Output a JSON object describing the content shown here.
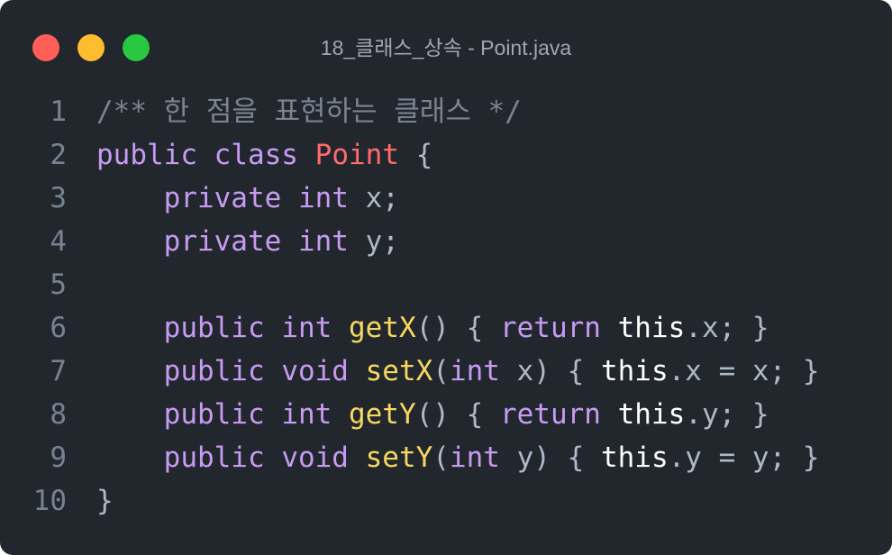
{
  "window": {
    "title": "18_클래스_상속 - Point.java",
    "controls": {
      "close": "close-button",
      "minimize": "minimize-button",
      "zoom": "zoom-button"
    }
  },
  "colors": {
    "background": "#22272e",
    "close": "#ff5f57",
    "minimize": "#febc2e",
    "zoom": "#28c840",
    "keyword": "#c79bf2",
    "class_name": "#ff6b6b",
    "method": "#f6d860",
    "this": "#ffffff",
    "comment": "#7a8592",
    "plain": "#adbac7",
    "line_number": "#768390"
  },
  "code": {
    "lines": [
      {
        "number": "1",
        "tokens": [
          {
            "t": "/** 한 점을 표현하는 클래스 */",
            "c": "cm"
          }
        ]
      },
      {
        "number": "2",
        "tokens": [
          {
            "t": "public",
            "c": "kw"
          },
          {
            "t": " ",
            "c": "pl"
          },
          {
            "t": "class",
            "c": "kw"
          },
          {
            "t": " ",
            "c": "pl"
          },
          {
            "t": "Point",
            "c": "cls"
          },
          {
            "t": " {",
            "c": "pl"
          }
        ]
      },
      {
        "number": "3",
        "tokens": [
          {
            "t": "    ",
            "c": "pl"
          },
          {
            "t": "private",
            "c": "kw"
          },
          {
            "t": " ",
            "c": "pl"
          },
          {
            "t": "int",
            "c": "kw"
          },
          {
            "t": " x;",
            "c": "pl"
          }
        ]
      },
      {
        "number": "4",
        "tokens": [
          {
            "t": "    ",
            "c": "pl"
          },
          {
            "t": "private",
            "c": "kw"
          },
          {
            "t": " ",
            "c": "pl"
          },
          {
            "t": "int",
            "c": "kw"
          },
          {
            "t": " y;",
            "c": "pl"
          }
        ]
      },
      {
        "number": "5",
        "tokens": []
      },
      {
        "number": "6",
        "tokens": [
          {
            "t": "    ",
            "c": "pl"
          },
          {
            "t": "public",
            "c": "kw"
          },
          {
            "t": " ",
            "c": "pl"
          },
          {
            "t": "int",
            "c": "kw"
          },
          {
            "t": " ",
            "c": "pl"
          },
          {
            "t": "getX",
            "c": "fn"
          },
          {
            "t": "() { ",
            "c": "pl"
          },
          {
            "t": "return",
            "c": "kw"
          },
          {
            "t": " ",
            "c": "pl"
          },
          {
            "t": "this",
            "c": "this"
          },
          {
            "t": ".x; }",
            "c": "pl"
          }
        ]
      },
      {
        "number": "7",
        "tokens": [
          {
            "t": "    ",
            "c": "pl"
          },
          {
            "t": "public",
            "c": "kw"
          },
          {
            "t": " ",
            "c": "pl"
          },
          {
            "t": "void",
            "c": "kw"
          },
          {
            "t": " ",
            "c": "pl"
          },
          {
            "t": "setX",
            "c": "fn"
          },
          {
            "t": "(",
            "c": "pl"
          },
          {
            "t": "int",
            "c": "kw"
          },
          {
            "t": " x) { ",
            "c": "pl"
          },
          {
            "t": "this",
            "c": "this"
          },
          {
            "t": ".x = x; }",
            "c": "pl"
          }
        ]
      },
      {
        "number": "8",
        "tokens": [
          {
            "t": "    ",
            "c": "pl"
          },
          {
            "t": "public",
            "c": "kw"
          },
          {
            "t": " ",
            "c": "pl"
          },
          {
            "t": "int",
            "c": "kw"
          },
          {
            "t": " ",
            "c": "pl"
          },
          {
            "t": "getY",
            "c": "fn"
          },
          {
            "t": "() { ",
            "c": "pl"
          },
          {
            "t": "return",
            "c": "kw"
          },
          {
            "t": " ",
            "c": "pl"
          },
          {
            "t": "this",
            "c": "this"
          },
          {
            "t": ".y; }",
            "c": "pl"
          }
        ]
      },
      {
        "number": "9",
        "tokens": [
          {
            "t": "    ",
            "c": "pl"
          },
          {
            "t": "public",
            "c": "kw"
          },
          {
            "t": " ",
            "c": "pl"
          },
          {
            "t": "void",
            "c": "kw"
          },
          {
            "t": " ",
            "c": "pl"
          },
          {
            "t": "setY",
            "c": "fn"
          },
          {
            "t": "(",
            "c": "pl"
          },
          {
            "t": "int",
            "c": "kw"
          },
          {
            "t": " y) { ",
            "c": "pl"
          },
          {
            "t": "this",
            "c": "this"
          },
          {
            "t": ".y = y; }",
            "c": "pl"
          }
        ]
      },
      {
        "number": "10",
        "tokens": [
          {
            "t": "}",
            "c": "pl"
          }
        ]
      }
    ]
  }
}
